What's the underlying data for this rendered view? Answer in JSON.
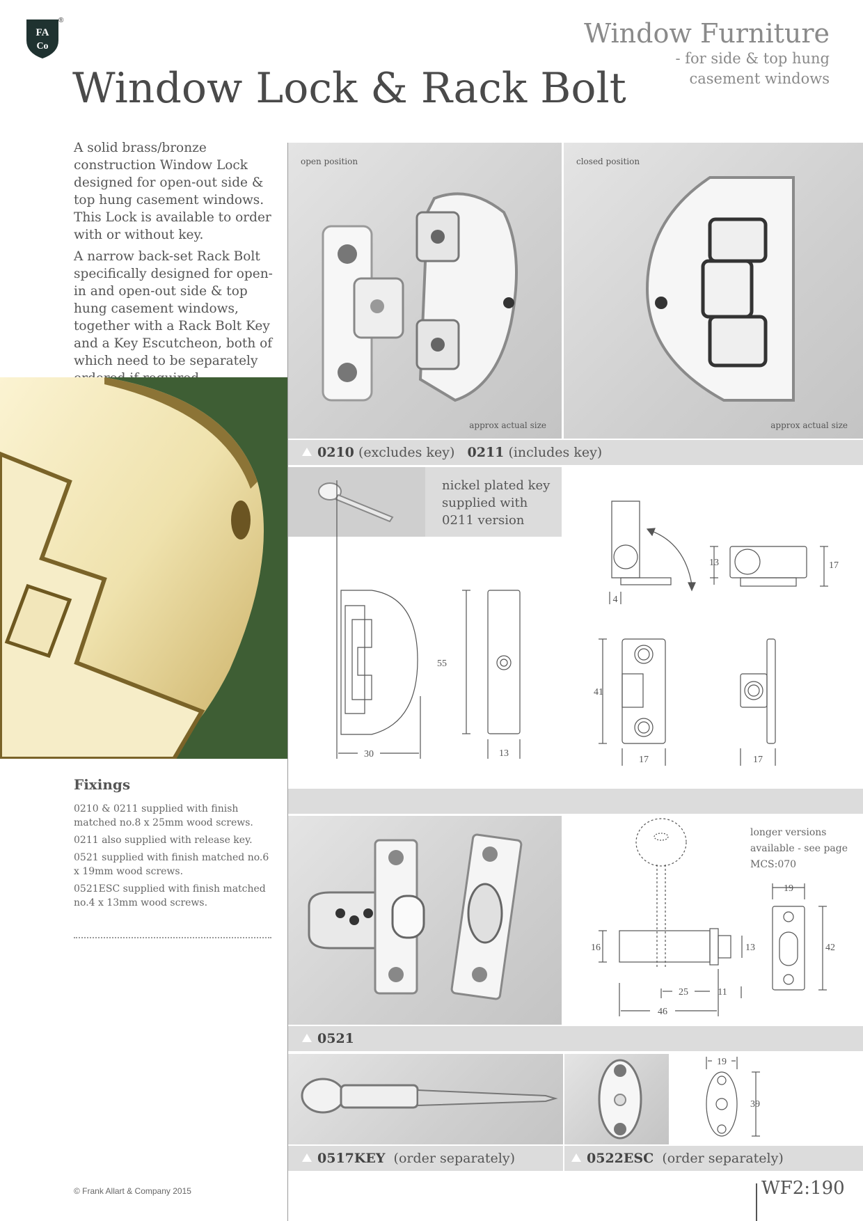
{
  "brand": {
    "logo_letters": "FA Co",
    "registered": "®"
  },
  "header": {
    "category": "Window Furniture",
    "subtitle_line1": "- for side & top hung",
    "subtitle_line2": "casement windows",
    "title": "Window Lock & Rack Bolt"
  },
  "intro": [
    "A solid brass/bronze construction Window Lock designed for open-out side & top hung casement windows. This Lock is available to order with or without key.",
    "A narrow back-set Rack Bolt specifically designed for open-in and open-out side & top hung casement windows, together with a Rack Bolt Key and a Key Escutcheon, both of which need to be separately ordered if required."
  ],
  "fixings": {
    "title": "Fixings",
    "items": [
      "0210 & 0211 supplied with finish matched no.8 x 25mm wood screws.",
      "0211 also supplied with release key.",
      "0521 supplied with finish matched no.6 x 19mm wood screws.",
      "0521ESC supplied with finish matched no.4 x 13mm wood screws."
    ]
  },
  "photos": {
    "open_label": "open position",
    "closed_label": "closed position",
    "approx_label": "approx actual size"
  },
  "lock_caption": {
    "code1": "0210",
    "desc1": "(excludes key)",
    "code2": "0211",
    "desc2": "(includes key)"
  },
  "key_note": {
    "line1": "nickel plated key",
    "line2": "supplied with",
    "line3": "0211 version"
  },
  "dims_lock": {
    "d30": "30",
    "d13a": "13",
    "d55": "55",
    "d41": "41",
    "d17a": "17",
    "d17b": "17",
    "d4": "4",
    "d13b": "13",
    "d17c": "17"
  },
  "bolt_caption": {
    "code": "0521"
  },
  "bolt_note": {
    "line1": "longer versions",
    "line2": "available - see page",
    "line3": "MCS:070"
  },
  "dims_bolt": {
    "d19": "19",
    "d16": "16",
    "d13": "13",
    "d42": "42",
    "d25": "25",
    "d11": "11",
    "d46": "46"
  },
  "key_caption": {
    "code": "0517KEY",
    "desc": "(order separately)"
  },
  "esc_caption": {
    "code": "0522ESC",
    "desc": "(order separately)"
  },
  "dims_esc": {
    "d19": "19",
    "d39": "39"
  },
  "footer": {
    "copyright": "© Frank Allart & Company 2015",
    "page_ref": "WF2:190"
  },
  "colors": {
    "accent_green": "#3e5e34",
    "panel_grey": "#dcdcdc",
    "text": "#555555"
  }
}
